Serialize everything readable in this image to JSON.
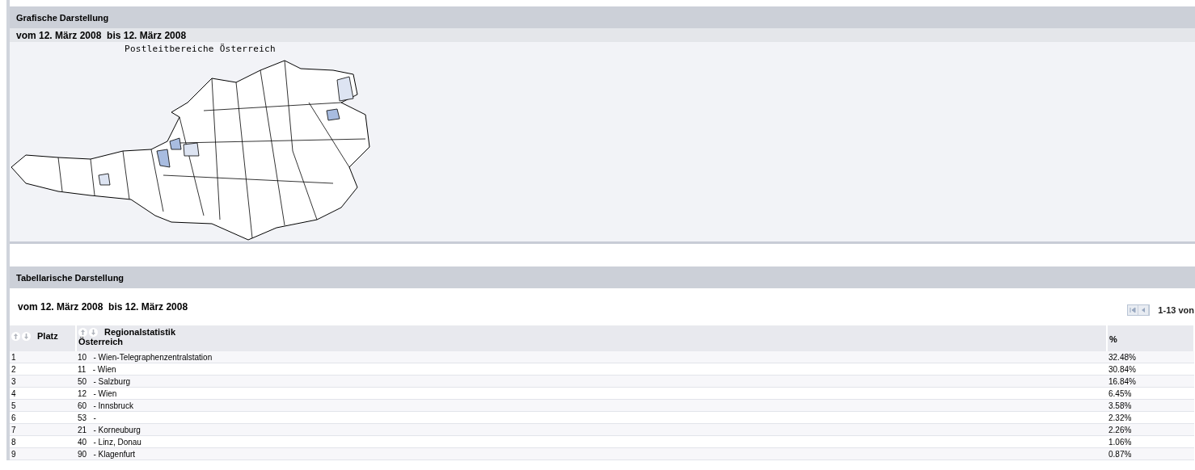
{
  "graphic_section": {
    "title": "Grafische Darstellung",
    "date_range": "vom 12. März 2008  bis 12. März 2008",
    "map_title": "Postleitbereiche Österreich"
  },
  "table_section": {
    "title": "Tabellarische Darstellung",
    "date_range": "vom 12. März 2008  bis 12. März 2008",
    "pager": {
      "range": "1-13 von"
    },
    "columns": [
      {
        "label": "Platz",
        "sortable": true
      },
      {
        "label": "Regionalstatistik",
        "sublabel": "Österreich",
        "sortable": true
      },
      {
        "label": "%",
        "sortable": false
      }
    ],
    "rows": [
      {
        "rank": "1",
        "region": "10   - Wien-Telegraphenzentralstation",
        "percent": "32.48%"
      },
      {
        "rank": "2",
        "region": "11   - Wien",
        "percent": "30.84%"
      },
      {
        "rank": "3",
        "region": "50   - Salzburg",
        "percent": "16.84%"
      },
      {
        "rank": "4",
        "region": "12   - Wien",
        "percent": "6.45%"
      },
      {
        "rank": "5",
        "region": "60   - Innsbruck",
        "percent": "3.58%"
      },
      {
        "rank": "6",
        "region": "53   -",
        "percent": "2.32%"
      },
      {
        "rank": "7",
        "region": "21   - Korneuburg",
        "percent": "2.26%"
      },
      {
        "rank": "8",
        "region": "40   - Linz, Donau",
        "percent": "1.06%"
      },
      {
        "rank": "9",
        "region": "90   - Klagenfurt",
        "percent": "0.87%"
      }
    ]
  }
}
